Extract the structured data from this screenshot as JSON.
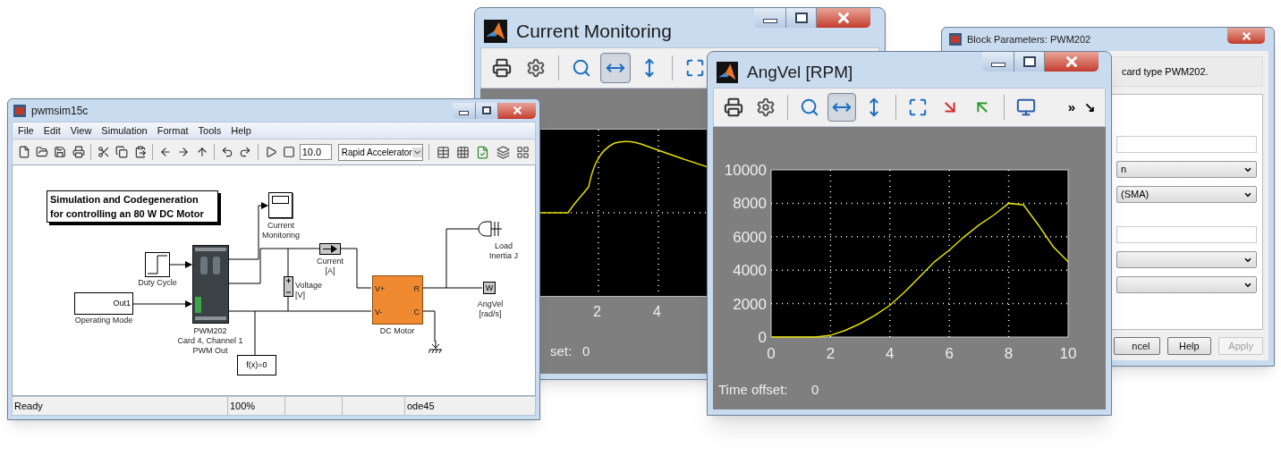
{
  "block_parameters": {
    "title": "Block Parameters: PWM202",
    "description": "card type PWM202.",
    "fields": [
      {
        "kind": "text"
      },
      {
        "kind": "dropdown",
        "value": "n"
      },
      {
        "kind": "dropdown",
        "value": "(SMA)"
      },
      {
        "kind": "text"
      },
      {
        "kind": "dropdown"
      },
      {
        "kind": "dropdown"
      }
    ],
    "buttons": [
      {
        "label": "ncel",
        "disabled": false
      },
      {
        "label": "Help",
        "disabled": false
      },
      {
        "label": "Apply",
        "disabled": true
      }
    ]
  },
  "current_monitoring": {
    "title": "Current Monitoring",
    "tools": [
      {
        "kind": "print",
        "selected": false
      },
      {
        "kind": "parameters",
        "selected": false
      },
      {
        "kind": "zoom",
        "selected": false
      },
      {
        "kind": "zoom_x",
        "selected": true
      },
      {
        "kind": "zoom_y",
        "selected": false
      },
      {
        "kind": "autoscale",
        "selected": false
      }
    ],
    "x_tick_labels": [
      "2",
      "4"
    ],
    "time_offset_label": "set:",
    "time_offset_value": "0"
  },
  "model_window": {
    "title": "pwmsim15c",
    "menu": [
      "File",
      "Edit",
      "View",
      "Simulation",
      "Format",
      "Tools",
      "Help"
    ],
    "stop_time": "10.0",
    "simulation_mode": "Rapid Accelerator",
    "blocks": [
      {
        "kind": "annotation",
        "lines": [
          "Simulation and Codegeneration",
          "for controlling an 80 W DC Motor"
        ]
      },
      {
        "kind": "scope",
        "label": [
          "Current",
          "Monitoring"
        ]
      },
      {
        "kind": "step",
        "label": [
          "Duty Cycle"
        ]
      },
      {
        "kind": "inport",
        "port": "Out1",
        "label": [
          "Operating Mode"
        ]
      },
      {
        "kind": "pwm_card",
        "label": [
          "PWM202",
          "Card 4, Channel 1",
          "PWM Out"
        ]
      },
      {
        "kind": "current_sensor",
        "label": [
          "Current",
          "[A]"
        ]
      },
      {
        "kind": "voltage_sensor",
        "label": [
          "Voltage",
          "[V]"
        ]
      },
      {
        "kind": "dc_motor",
        "ports": [
          "V+",
          "V-",
          "R",
          "C"
        ],
        "label": [
          "DC Motor"
        ]
      },
      {
        "kind": "inertia",
        "label": [
          "Load",
          "Inertia J"
        ]
      },
      {
        "kind": "angvel_sensor",
        "port": "W",
        "label": [
          "AngVel",
          "[rad/s]"
        ]
      },
      {
        "kind": "solver",
        "text": "f(x)=0"
      },
      {
        "kind": "ground"
      }
    ],
    "status_bar": {
      "message": "Ready",
      "zoom": "100%",
      "solver": "ode45"
    }
  },
  "angvel": {
    "title": "AngVel [RPM]",
    "tools": [
      {
        "kind": "print",
        "selected": false
      },
      {
        "kind": "parameters",
        "selected": false
      },
      {
        "kind": "zoom",
        "selected": false
      },
      {
        "kind": "zoom_x",
        "selected": true
      },
      {
        "kind": "zoom_y",
        "selected": false
      },
      {
        "kind": "autoscale",
        "selected": false
      },
      {
        "kind": "save_axes",
        "selected": false
      },
      {
        "kind": "restore_axes",
        "selected": false
      },
      {
        "kind": "floating_scope",
        "selected": false
      }
    ],
    "overflow_glyphs": [
      "»",
      "↘"
    ],
    "chart_data": {
      "type": "line",
      "x": [
        0,
        0.5,
        1,
        1.5,
        2,
        2.5,
        3,
        3.5,
        4,
        4.5,
        5,
        5.5,
        6,
        6.5,
        7,
        7.5,
        8,
        8.5,
        9,
        9.5,
        10
      ],
      "values": [
        0,
        0,
        0,
        0,
        100,
        400,
        800,
        1300,
        1900,
        2700,
        3600,
        4500,
        5200,
        6000,
        6700,
        7300,
        8000,
        7900,
        6700,
        5400,
        4500
      ],
      "xlim": [
        0,
        10
      ],
      "ylim": [
        0,
        10000
      ],
      "grid": true,
      "xticks": [
        0,
        2,
        4,
        6,
        8,
        10
      ],
      "yticks": [
        0,
        2000,
        4000,
        6000,
        8000,
        10000
      ]
    },
    "time_offset_label": "Time offset:",
    "time_offset_value": "0"
  }
}
